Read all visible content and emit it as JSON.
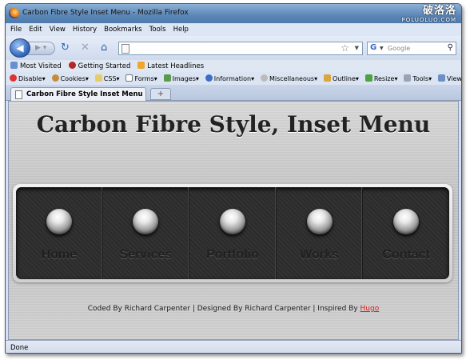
{
  "window": {
    "title": "Carbon Fibre Style Inset Menu - Mozilla Firefox"
  },
  "watermark": {
    "line1": "破洛洛",
    "line2": "POLUOLUO.COM"
  },
  "menubar": [
    "File",
    "Edit",
    "View",
    "History",
    "Bookmarks",
    "Tools",
    "Help"
  ],
  "search": {
    "placeholder": "Google"
  },
  "bookmarks": [
    "Most Visited",
    "Getting Started",
    "Latest Headlines"
  ],
  "devbar": [
    "Disable",
    "Cookies",
    "CSS",
    "Forms",
    "Images",
    "Information",
    "Miscellaneous",
    "Outline",
    "Resize",
    "Tools",
    "View Source"
  ],
  "tab": {
    "label": "Carbon Fibre Style Inset Menu"
  },
  "page": {
    "heading": "Carbon Fibre Style, Inset Menu",
    "menu": [
      "Home",
      "Services",
      "Portfolio",
      "Works",
      "Contact"
    ],
    "footer": {
      "text": "Coded By Richard Carpenter | Designed By Richard Carpenter | Inspired By ",
      "link": "Hugo"
    }
  },
  "status": "Done",
  "colors": {
    "footer_link": "#e01a1a",
    "menu_bg": "#2f2f2f",
    "page_bg": "#cccccc"
  }
}
